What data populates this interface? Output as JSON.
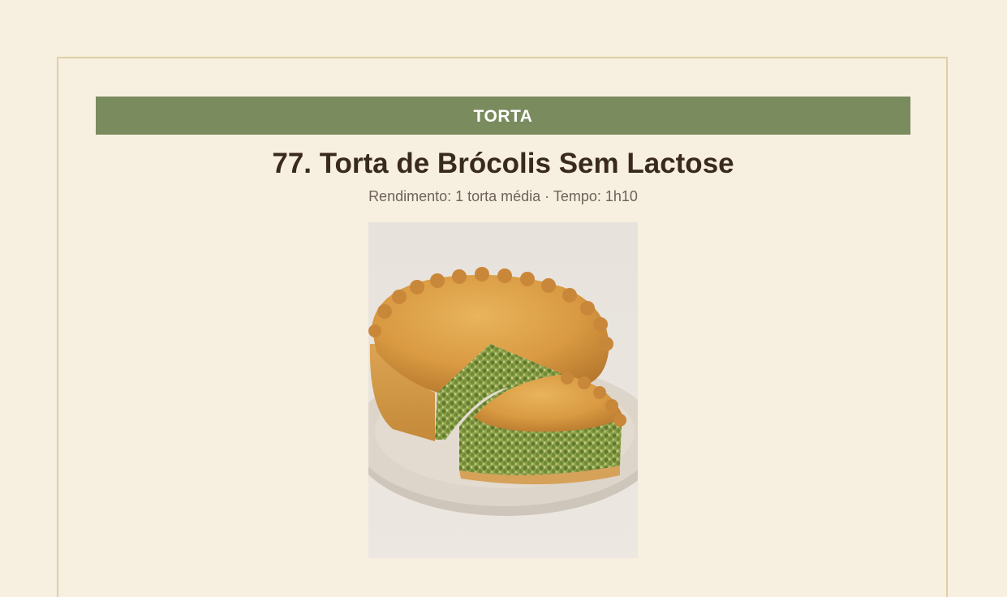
{
  "recipe": {
    "category": "TORTA",
    "title": "77. Torta de Brócolis Sem Lactose",
    "meta": "Rendimento: 1 torta média · Tempo: 1h10",
    "photo_subject": "broccoli-pie-photo"
  },
  "colors": {
    "background": "#f7f0e1",
    "border": "#e0cfa2",
    "category_bar": "#7a8b5e",
    "title": "#3a2a1e",
    "meta": "#6e6259"
  }
}
